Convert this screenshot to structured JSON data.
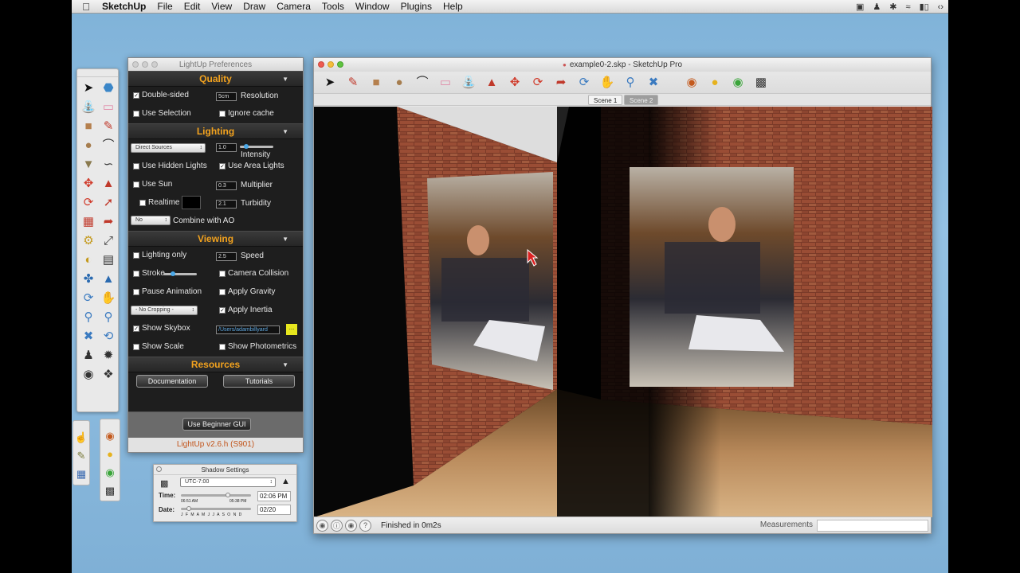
{
  "menubar": {
    "app": "SketchUp",
    "items": [
      "File",
      "Edit",
      "View",
      "Draw",
      "Camera",
      "Tools",
      "Window",
      "Plugins",
      "Help"
    ]
  },
  "lightup": {
    "title": "LightUp Preferences",
    "sections": {
      "quality": "Quality",
      "lighting": "Lighting",
      "viewing": "Viewing",
      "resources": "Resources"
    },
    "quality": {
      "double_sided": "Double-sided",
      "double_sided_checked": true,
      "resolution_value": "5cm",
      "resolution": "Resolution",
      "use_selection": "Use Selection",
      "ignore_cache": "Ignore cache"
    },
    "lighting": {
      "source_select": "Direct Sources",
      "intensity_value": "1.0",
      "intensity": "Intensity",
      "intensity_level": 0.15,
      "use_hidden_lights": "Use Hidden Lights",
      "use_area_lights": "Use Area Lights",
      "use_area_lights_checked": true,
      "use_sun": "Use Sun",
      "multiplier_value": "0.3",
      "multiplier": "Multiplier",
      "realtime": "Realtime",
      "turbidity_value": "2.1",
      "turbidity": "Turbidity",
      "ao_select": "No",
      "combine_ao": "Combine with AO"
    },
    "viewing": {
      "lighting_only": "Lighting only",
      "speed_value": "2.5",
      "speed": "Speed",
      "stroke": "Stroke",
      "stroke_level": 0.25,
      "camera_collision": "Camera Collision",
      "pause_animation": "Pause Animation",
      "apply_gravity": "Apply Gravity",
      "cropping_select": "- No Cropping -",
      "apply_inertia": "Apply Inertia",
      "apply_inertia_checked": true,
      "show_skybox": "Show Skybox",
      "show_skybox_checked": true,
      "skybox_path": "/Users/adambillyard",
      "browse": "...",
      "show_scale": "Show Scale",
      "show_photometrics": "Show Photometrics"
    },
    "resources": {
      "documentation": "Documentation",
      "tutorials": "Tutorials"
    },
    "beginner_gui": "Use Beginner GUI",
    "version": "LightUp v2.6.h (S901)"
  },
  "shadow": {
    "title": "Shadow Settings",
    "timezone": "UTC-7:00",
    "time_label": "Time:",
    "time_start": "06:51 AM",
    "time_end": "05:38 PM",
    "time_value": "02:06 PM",
    "date_label": "Date:",
    "months": "J F M A M J J A S O N D",
    "date_value": "02/20"
  },
  "main": {
    "title": "example0-2.skp - SketchUp Pro",
    "scenes": [
      "Scene 1",
      "Scene 2"
    ],
    "status": "Finished in 0m2s",
    "measurements": "Measurements"
  },
  "colors": {
    "accent_orange": "#f2a21e",
    "version_text": "#c2541a",
    "desktop": "#8dbde0"
  }
}
